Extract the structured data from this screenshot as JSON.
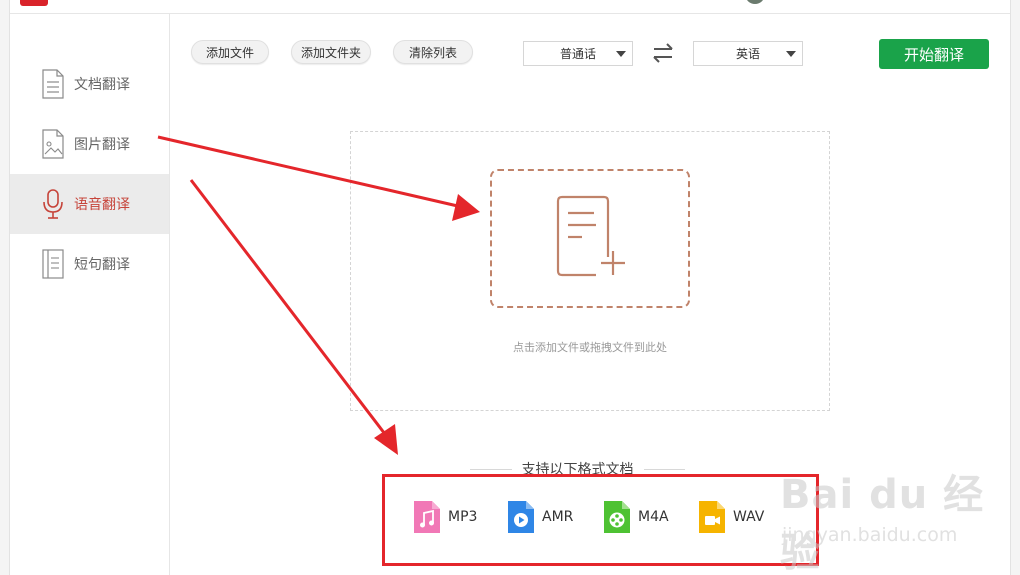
{
  "sidebar": {
    "items": [
      {
        "label": "文档翻译",
        "icon": "document-icon",
        "active": false
      },
      {
        "label": "图片翻译",
        "icon": "image-icon",
        "active": false
      },
      {
        "label": "语音翻译",
        "icon": "microphone-icon",
        "active": true
      },
      {
        "label": "短句翻译",
        "icon": "sentence-icon",
        "active": false
      }
    ]
  },
  "toolbar": {
    "add_file": "添加文件",
    "add_folder": "添加文件夹",
    "clear_list": "清除列表",
    "source_lang": "普通话",
    "target_lang": "英语",
    "start": "开始翻译"
  },
  "dropzone": {
    "hint": "点击添加文件或拖拽文件到此处"
  },
  "formats": {
    "title": "支持以下格式文档",
    "items": [
      {
        "label": "MP3",
        "icon": "music-file-icon",
        "color": "#f178b6"
      },
      {
        "label": "AMR",
        "icon": "play-file-icon",
        "color": "#2f86e6"
      },
      {
        "label": "M4A",
        "icon": "film-reel-file-icon",
        "color": "#4ec233"
      },
      {
        "label": "WAV",
        "icon": "video-camera-file-icon",
        "color": "#f6b400"
      }
    ]
  },
  "watermark": {
    "logo": "Bai du 经验",
    "url": "jingyan.baidu.com"
  },
  "colors": {
    "accent_green": "#1aa34a",
    "active_red": "#c6443a",
    "annotation_red": "#e4262b",
    "drop_border": "#c0836a"
  }
}
